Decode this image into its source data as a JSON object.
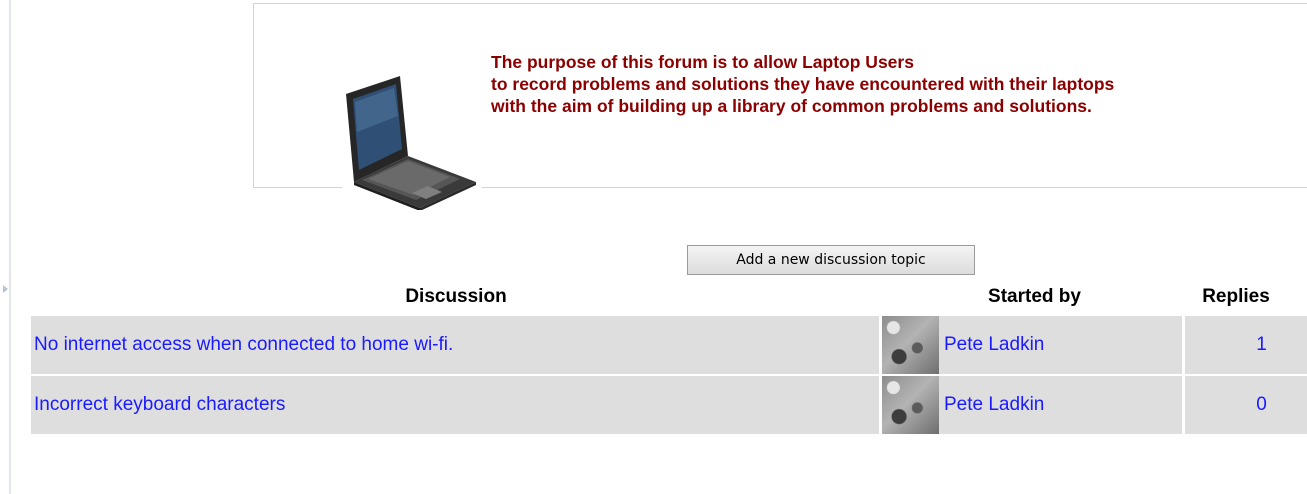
{
  "intro": {
    "line1": "The purpose of this forum is to allow Laptop Users",
    "line2": "to record problems and solutions they have encountered with their laptops",
    "line3": "with the aim of building up a library of common problems and solutions."
  },
  "add_topic_label": "Add a new discussion topic",
  "table": {
    "headers": {
      "discussion": "Discussion",
      "started_by": "Started by",
      "replies": "Replies"
    },
    "rows": [
      {
        "topic": "No internet access when connected to home wi-fi.",
        "author": "Pete Ladkin",
        "replies": "1"
      },
      {
        "topic": "Incorrect keyboard characters",
        "author": "Pete Ladkin",
        "replies": "0"
      }
    ]
  },
  "colors": {
    "intro_text": "#8b0000",
    "link": "#1a1aff",
    "row_background": "#dedede"
  }
}
